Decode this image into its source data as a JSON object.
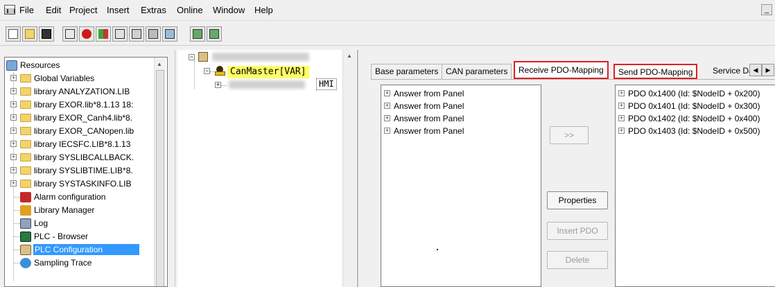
{
  "menu": {
    "items": [
      "File",
      "Edit",
      "Project",
      "Insert",
      "Extras",
      "Online",
      "Window",
      "Help"
    ],
    "minimize_glyph": "_"
  },
  "toolbar": {
    "buttons": [
      "new-icon",
      "open-icon",
      "save-icon",
      "compile-icon",
      "stop-icon",
      "run-icon",
      "login-icon",
      "logout-icon",
      "monitor-icon",
      "step-icon",
      "breakpoint-icon"
    ]
  },
  "resources": {
    "title": "Resources",
    "items": [
      {
        "label": "Global Variables",
        "type": "folder",
        "expandable": true
      },
      {
        "label": "library ANALYZATION.LIB",
        "type": "folder",
        "expandable": true
      },
      {
        "label": "library EXOR.lib*8.1.13 18:",
        "type": "folder",
        "expandable": true
      },
      {
        "label": "library EXOR_Canh4.lib*8.",
        "type": "folder",
        "expandable": true
      },
      {
        "label": "library EXOR_CANopen.lib",
        "type": "folder",
        "expandable": true
      },
      {
        "label": "library IECSFC.LIB*8.1.13",
        "type": "folder",
        "expandable": true
      },
      {
        "label": "library SYSLIBCALLBACK.",
        "type": "folder",
        "expandable": true
      },
      {
        "label": "library SYSLIBTIME.LIB*8.",
        "type": "folder",
        "expandable": true
      },
      {
        "label": "library SYSTASKINFO.LIB",
        "type": "folder",
        "expandable": true
      },
      {
        "label": "Alarm configuration",
        "type": "alarm",
        "expandable": false
      },
      {
        "label": "Library Manager",
        "type": "library",
        "expandable": false
      },
      {
        "label": "Log",
        "type": "log",
        "expandable": false
      },
      {
        "label": "PLC - Browser",
        "type": "browser",
        "expandable": false
      },
      {
        "label": "PLC Configuration",
        "type": "plc",
        "expandable": false,
        "selected": true
      },
      {
        "label": "Sampling Trace",
        "type": "trace",
        "expandable": false
      }
    ]
  },
  "config_tree": {
    "root_label": "",
    "master_label": "CanMaster[VAR]",
    "child_tag": "HMI"
  },
  "tabs": {
    "items": [
      "Base parameters",
      "CAN parameters",
      "Receive PDO-Mapping",
      "Send PDO-Mapping",
      "Service Da"
    ],
    "active": "Receive PDO-Mapping"
  },
  "left_list": {
    "rows": [
      "Answer from Panel",
      "Answer from Panel",
      "Answer from Panel",
      "Answer from Panel"
    ]
  },
  "right_list": {
    "rows": [
      "PDO 0x1400 (Id: $NodeID + 0x200)",
      "PDO 0x1401 (Id: $NodeID + 0x300)",
      "PDO 0x1402 (Id: $NodeID + 0x400)",
      "PDO 0x1403 (Id: $NodeID + 0x500)"
    ]
  },
  "buttons": {
    "move": ">>",
    "properties": "Properties",
    "insert_pdo": "Insert PDO",
    "delete": "Delete"
  },
  "colors": {
    "highlight_border": "#e02020",
    "selection": "#3399ff",
    "master_highlight": "#ffff66"
  }
}
